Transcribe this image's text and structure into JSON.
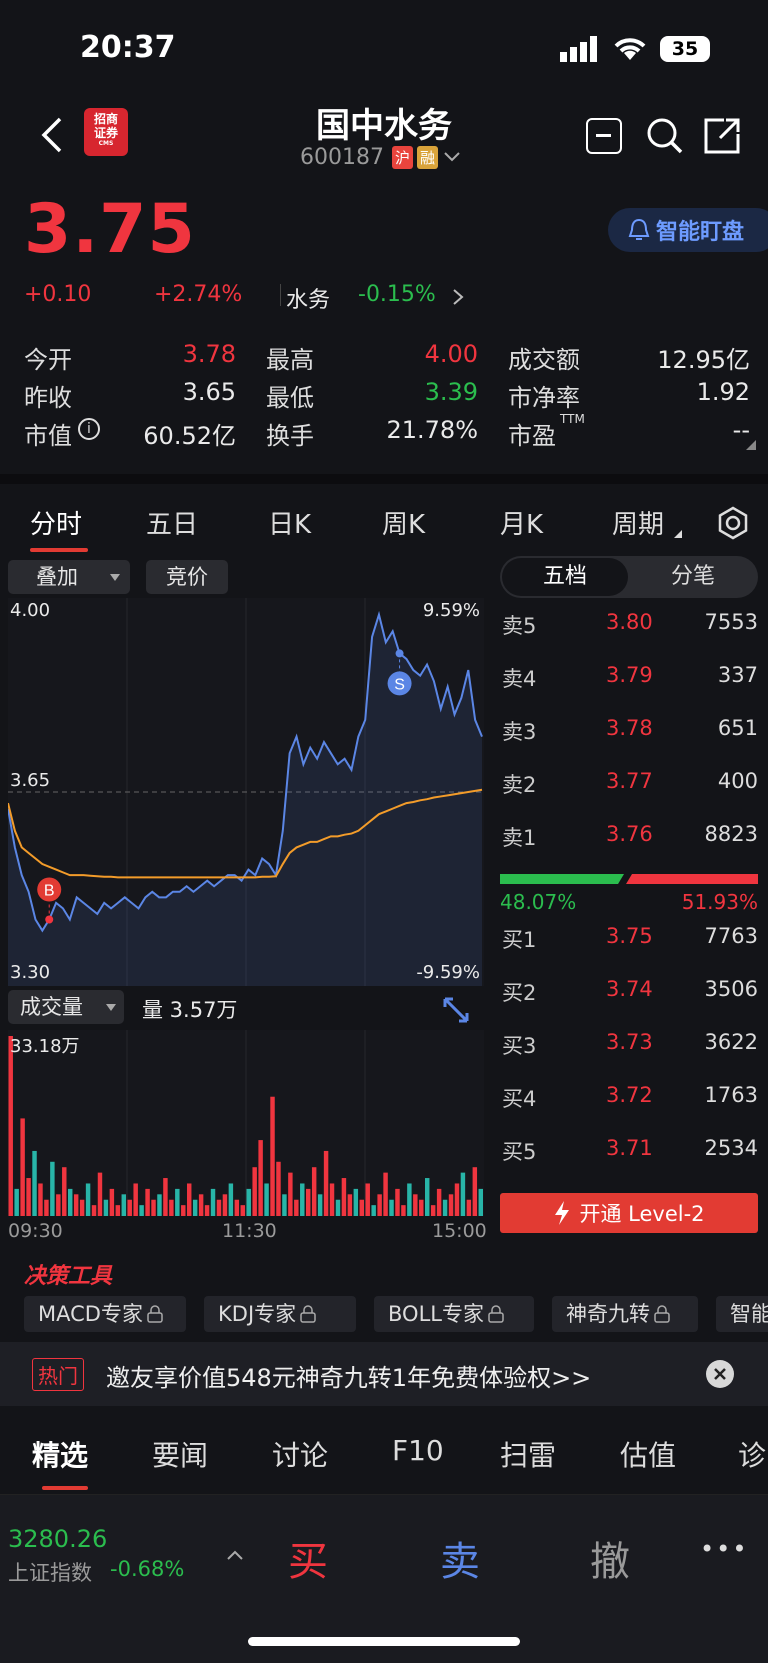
{
  "colors": {
    "up": "#f0353f",
    "down": "#2bbd4e",
    "price_line": "#5b86e5",
    "avg_line": "#f39c2a",
    "bg": "#131418",
    "panel": "#1a1b20"
  },
  "status": {
    "time": "20:37",
    "battery": "35"
  },
  "header": {
    "title": "国中水务",
    "code": "600187",
    "badge_sh": "沪",
    "badge_margin": "融",
    "broker_logo": "招商证券",
    "broker_logo_en": "CMS",
    "alert_label": "智能盯盘"
  },
  "quote": {
    "price": "3.75",
    "change": "+0.10",
    "change_pct": "+2.74%",
    "sector": "水务",
    "sector_pct": "-0.15%",
    "stats": [
      [
        {
          "label": "今开",
          "value": "3.78",
          "tone": "red"
        },
        {
          "label": "最高",
          "value": "4.00",
          "tone": "red"
        },
        {
          "label": "成交额",
          "value": "12.95亿",
          "tone": "wht"
        }
      ],
      [
        {
          "label": "昨收",
          "value": "3.65",
          "tone": "wht"
        },
        {
          "label": "最低",
          "value": "3.39",
          "tone": "green"
        },
        {
          "label": "市净率",
          "value": "1.92",
          "tone": "wht"
        }
      ],
      [
        {
          "label": "市值",
          "value": "60.52亿",
          "tone": "wht"
        },
        {
          "label": "换手",
          "value": "21.78%",
          "tone": "wht"
        },
        {
          "label": "市盈",
          "value": "--",
          "tone": "wht"
        }
      ]
    ],
    "pe_suffix": "TTM"
  },
  "tabs": [
    "分时",
    "五日",
    "日K",
    "周K",
    "月K",
    "周期"
  ],
  "chart_controls": {
    "overlay": "叠加",
    "auction": "竞价",
    "volume_label": "成交量",
    "volume_value": "量 3.57万"
  },
  "chart_data": {
    "type": "line",
    "price_axis": {
      "top": "4.00",
      "mid": "3.65",
      "bottom": "3.30",
      "top_pct": "9.59%",
      "bottom_pct": "-9.59%",
      "ylim": [
        3.3,
        4.0
      ],
      "prev_close": 3.65
    },
    "x_labels": [
      "09:30",
      "11:30",
      "15:00"
    ],
    "series": [
      {
        "key": "price",
        "values": [
          3.62,
          3.55,
          3.5,
          3.47,
          3.42,
          3.4,
          3.42,
          3.45,
          3.44,
          3.42,
          3.46,
          3.45,
          3.44,
          3.43,
          3.45,
          3.44,
          3.45,
          3.46,
          3.45,
          3.44,
          3.46,
          3.47,
          3.46,
          3.46,
          3.47,
          3.47,
          3.48,
          3.47,
          3.48,
          3.49,
          3.48,
          3.49,
          3.5,
          3.5,
          3.49,
          3.51,
          3.5,
          3.53,
          3.52,
          3.5,
          3.58,
          3.72,
          3.75,
          3.7,
          3.73,
          3.71,
          3.74,
          3.72,
          3.7,
          3.71,
          3.69,
          3.75,
          3.78,
          3.93,
          3.97,
          3.92,
          3.94,
          3.9,
          3.89,
          3.87,
          3.86,
          3.88,
          3.85,
          3.8,
          3.84,
          3.79,
          3.82,
          3.87,
          3.78,
          3.75
        ]
      },
      {
        "key": "avg",
        "values": [
          3.63,
          3.58,
          3.55,
          3.54,
          3.53,
          3.52,
          3.515,
          3.51,
          3.505,
          3.5,
          3.5,
          3.5,
          3.499,
          3.498,
          3.497,
          3.497,
          3.496,
          3.496,
          3.496,
          3.496,
          3.496,
          3.496,
          3.496,
          3.496,
          3.496,
          3.496,
          3.496,
          3.496,
          3.496,
          3.496,
          3.496,
          3.496,
          3.496,
          3.496,
          3.496,
          3.496,
          3.496,
          3.497,
          3.497,
          3.498,
          3.52,
          3.54,
          3.55,
          3.555,
          3.56,
          3.56,
          3.565,
          3.57,
          3.57,
          3.573,
          3.575,
          3.58,
          3.59,
          3.6,
          3.61,
          3.615,
          3.62,
          3.625,
          3.63,
          3.632,
          3.635,
          3.637,
          3.64,
          3.642,
          3.644,
          3.646,
          3.648,
          3.65,
          3.652,
          3.654
        ]
      }
    ],
    "trade_markers": [
      {
        "label": "B",
        "index": 6
      },
      {
        "label": "S",
        "index": 57
      }
    ],
    "volume_max": "33.18万",
    "volume_values": [
      33.2,
      5,
      18,
      7,
      12,
      6,
      3,
      10,
      4,
      9,
      5,
      4,
      3,
      6,
      2,
      8,
      3,
      5,
      2,
      4,
      3,
      6,
      2,
      5,
      3,
      4,
      7,
      3,
      5,
      2,
      6,
      3,
      4,
      2,
      5,
      3,
      4,
      6,
      3,
      2,
      5,
      9,
      14,
      6,
      22,
      10,
      4,
      8,
      3,
      6,
      5,
      9,
      4,
      12,
      6,
      3,
      7,
      4,
      5,
      3,
      6,
      2,
      4,
      8,
      3,
      5,
      2,
      6,
      4,
      3,
      7,
      2,
      5,
      3,
      4,
      6,
      8,
      3,
      9,
      5
    ]
  },
  "orderbook": {
    "tabs": [
      "五档",
      "分笔"
    ],
    "sells": [
      {
        "label": "卖5",
        "price": "3.80",
        "vol": "7553"
      },
      {
        "label": "卖4",
        "price": "3.79",
        "vol": "337"
      },
      {
        "label": "卖3",
        "price": "3.78",
        "vol": "651"
      },
      {
        "label": "卖2",
        "price": "3.77",
        "vol": "400"
      },
      {
        "label": "卖1",
        "price": "3.76",
        "vol": "8823"
      }
    ],
    "buy_pct": "48.07%",
    "sell_pct": "51.93%",
    "buy_ratio": 0.4807,
    "buys": [
      {
        "label": "买1",
        "price": "3.75",
        "vol": "7763"
      },
      {
        "label": "买2",
        "price": "3.74",
        "vol": "3506"
      },
      {
        "label": "买3",
        "price": "3.73",
        "vol": "3622"
      },
      {
        "label": "买4",
        "price": "3.72",
        "vol": "1763"
      },
      {
        "label": "买5",
        "price": "3.71",
        "vol": "2534"
      }
    ],
    "level2_btn": "开通 Level-2"
  },
  "tools": {
    "title": "决策工具",
    "items": [
      "MACD专家",
      "KDJ专家",
      "BOLL专家",
      "神奇九转",
      "智能"
    ]
  },
  "promo": {
    "tag": "热门",
    "text": "邀友享价值548元神奇九转1年免费体验权>>"
  },
  "content_tabs": [
    "精选",
    "要闻",
    "讨论",
    "F10",
    "扫雷",
    "估值",
    "诊"
  ],
  "bottom": {
    "index_value": "3280.26",
    "index_name": "上证指数",
    "index_pct": "-0.68%",
    "buy": "买",
    "sell": "卖",
    "cancel": "撤",
    "more": "•••"
  }
}
